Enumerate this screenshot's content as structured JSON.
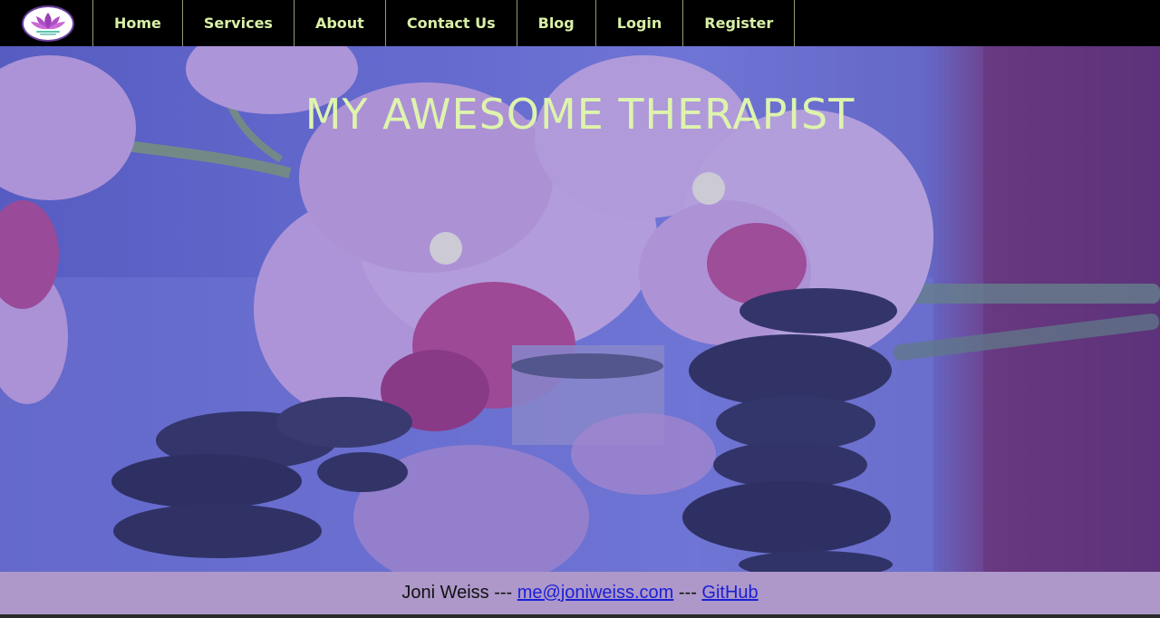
{
  "nav": {
    "logo_icon": "lotus-icon",
    "items": [
      "Home",
      "Services",
      "About",
      "Contact Us",
      "Blog",
      "Login",
      "Register"
    ]
  },
  "hero": {
    "title": "MY AWESOME THERAPIST",
    "background": "orchids-and-stones-image"
  },
  "footer": {
    "name": "Joni Weiss",
    "separator": " --- ",
    "email": "me@joniweiss.com",
    "github": "GitHub"
  },
  "colors": {
    "nav_bg": "#000000",
    "nav_text": "#d9f0a6",
    "title": "#def4ad",
    "footer_bg": "#ad98c9",
    "link": "#1b1fd6"
  }
}
